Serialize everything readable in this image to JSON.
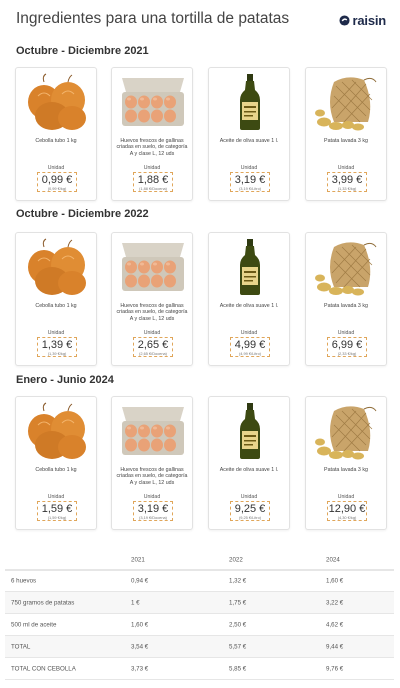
{
  "header": {
    "title": "Ingredientes para una tortilla de patatas",
    "brand": "raisin",
    "brand_color": "#1e2a4a"
  },
  "sections": [
    {
      "title": "Octubre - Diciembre 2021",
      "products": [
        {
          "icon": "onion-icon",
          "name": "Cebolla tubo 1 kg",
          "unit": "Unidad",
          "price": "0,99 €",
          "unit_price": "(0,99 €/kg)"
        },
        {
          "icon": "eggs-icon",
          "name": "Huevos frescos de gallinas criadas en suelo, de categoría A y clase L, 12 uds",
          "unit": "Unidad",
          "price": "1,88 €",
          "unit_price": "(1,88 €/Docena)"
        },
        {
          "icon": "oil-bottle-icon",
          "name": "Aceite de oliva suave 1 l.",
          "unit": "Unidad",
          "price": "3,19 €",
          "unit_price": "(3,19 €/Litro)"
        },
        {
          "icon": "potatoes-icon",
          "name": "Patata lavada 3 kg",
          "unit": "Unidad",
          "price": "3,99 €",
          "unit_price": "(1,33 €/kg)"
        }
      ]
    },
    {
      "title": "Octubre - Diciembre 2022",
      "products": [
        {
          "icon": "onion-icon",
          "name": "Cebolla tubo 1 kg",
          "unit": "Unidad",
          "price": "1,39 €",
          "unit_price": "(1,39 €/kg)"
        },
        {
          "icon": "eggs-icon",
          "name": "Huevos frescos de gallinas criadas en suelo, de categoría A y clase L, 12 uds",
          "unit": "Unidad",
          "price": "2,65 €",
          "unit_price": "(2,65 €/Docena)"
        },
        {
          "icon": "oil-bottle-icon",
          "name": "Aceite de oliva suave 1 l.",
          "unit": "Unidad",
          "price": "4,99 €",
          "unit_price": "(4,99 €/Litro)"
        },
        {
          "icon": "potatoes-icon",
          "name": "Patata lavada 3 kg",
          "unit": "Unidad",
          "price": "6,99 €",
          "unit_price": "(2,33 €/kg)"
        }
      ]
    },
    {
      "title": "Enero - Junio 2024",
      "products": [
        {
          "icon": "onion-icon",
          "name": "Cebolla tubo 1 kg",
          "unit": "Unidad",
          "price": "1,59 €",
          "unit_price": "(1,59 €/kg)"
        },
        {
          "icon": "eggs-icon",
          "name": "Huevos frescos de gallinas criadas en suelo, de categoría A y clase L, 12 uds",
          "unit": "Unidad",
          "price": "3,19 €",
          "unit_price": "(3,19 €/Docena)"
        },
        {
          "icon": "oil-bottle-icon",
          "name": "Aceite de oliva suave 1 l.",
          "unit": "Unidad",
          "price": "9,25 €",
          "unit_price": "(9,25 €/Litro)"
        },
        {
          "icon": "potatoes-icon",
          "name": "Patata lavada 3 kg",
          "unit": "Unidad",
          "price": "12,90 €",
          "unit_price": "(4,30 €/kg)"
        }
      ]
    }
  ],
  "table": {
    "headers": [
      "",
      "2021",
      "2022",
      "2024"
    ],
    "rows": [
      [
        "6 huevos",
        "0,94 €",
        "1,32 €",
        "1,60 €"
      ],
      [
        "750 gramos de patatas",
        "1 €",
        "1,75 €",
        "3,22 €"
      ],
      [
        "500 ml de aceite",
        "1,60 €",
        "2,50 €",
        "4,62 €"
      ],
      [
        "TOTAL",
        "3,54 €",
        "5,57 €",
        "9,44 €"
      ],
      [
        "TOTAL CON CEBOLLA",
        "3,73 €",
        "5,85 €",
        "9,76 €"
      ]
    ]
  },
  "colors": {
    "price_border": "#e0a65a",
    "oil_green": "#3d4a12",
    "onion": "#d9822b",
    "egg": "#e9a277",
    "potato": "#d8b45a",
    "sack": "#c9a46a"
  }
}
